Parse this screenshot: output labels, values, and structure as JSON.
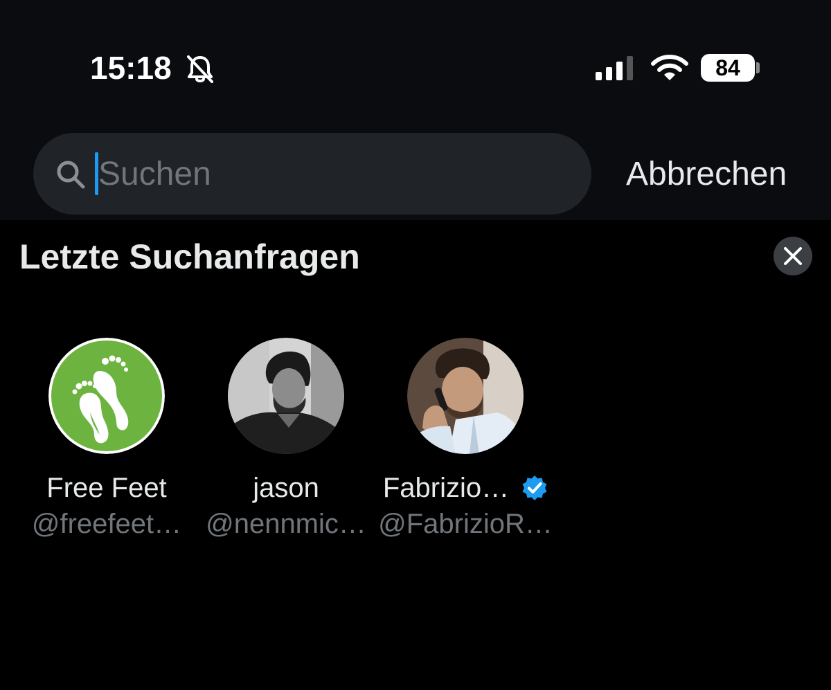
{
  "status_bar": {
    "time": "15:18",
    "battery": "84",
    "icons": [
      "bell-muted-icon",
      "cellular-signal-icon",
      "wifi-icon",
      "battery-icon"
    ]
  },
  "search": {
    "placeholder": "Suchen",
    "value": "",
    "cancel_label": "Abbrechen"
  },
  "recent": {
    "title": "Letzte Suchanfragen",
    "clear_icon": "close-icon",
    "items": [
      {
        "name": "Free Feet",
        "handle": "@freefeet…",
        "verified": false,
        "avatar_color": "#6db33f"
      },
      {
        "name": "jason",
        "handle": "@nennmic…",
        "verified": false,
        "avatar_color": "#7a7a7a"
      },
      {
        "name": "Fabrizio…",
        "handle": "@FabrizioR…",
        "verified": true,
        "avatar_color": "#8a7564"
      }
    ]
  },
  "colors": {
    "accent": "#1d9bf0",
    "background": "#000000",
    "header_background": "#0b0c0f",
    "secondary_text": "#71767b"
  }
}
